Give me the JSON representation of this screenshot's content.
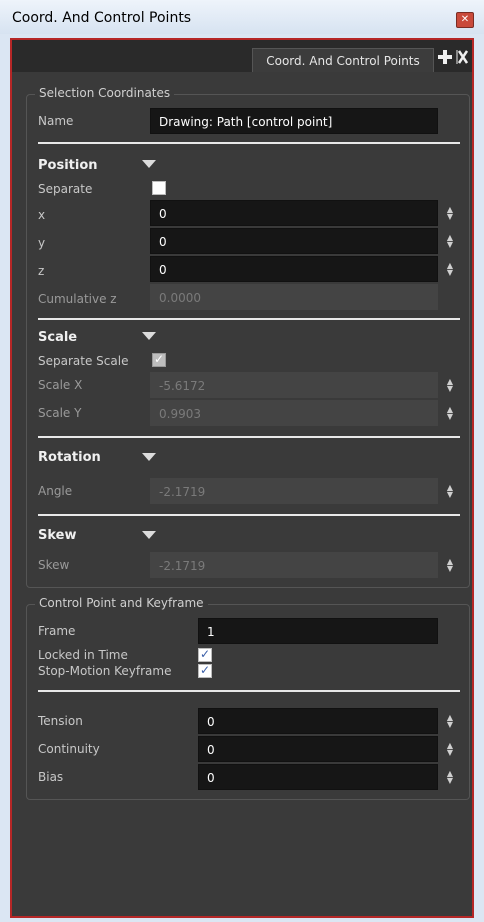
{
  "window": {
    "title": "Coord. And Control Points"
  },
  "tab": {
    "label": "Coord. And Control Points"
  },
  "selection": {
    "legend": "Selection Coordinates",
    "name_label": "Name",
    "name_value": "Drawing: Path [control point]",
    "position": {
      "header": "Position",
      "separate_label": "Separate",
      "x_label": "x",
      "x_value": "0",
      "y_label": "y",
      "y_value": "0",
      "z_label": "z",
      "z_value": "0",
      "cumz_label": "Cumulative z",
      "cumz_value": "0.0000"
    },
    "scale": {
      "header": "Scale",
      "sep_label": "Separate Scale",
      "sx_label": "Scale X",
      "sx_value": "-5.6172",
      "sy_label": "Scale Y",
      "sy_value": "0.9903"
    },
    "rotation": {
      "header": "Rotation",
      "angle_label": "Angle",
      "angle_value": "-2.1719"
    },
    "skew": {
      "header": "Skew",
      "skew_label": "Skew",
      "skew_value": "-2.1719"
    }
  },
  "control": {
    "legend": "Control Point and Keyframe",
    "frame_label": "Frame",
    "frame_value": "1",
    "locked_label": "Locked in Time",
    "stop_label": "Stop-Motion Keyframe",
    "tension_label": "Tension",
    "tension_value": "0",
    "continuity_label": "Continuity",
    "continuity_value": "0",
    "bias_label": "Bias",
    "bias_value": "0"
  }
}
